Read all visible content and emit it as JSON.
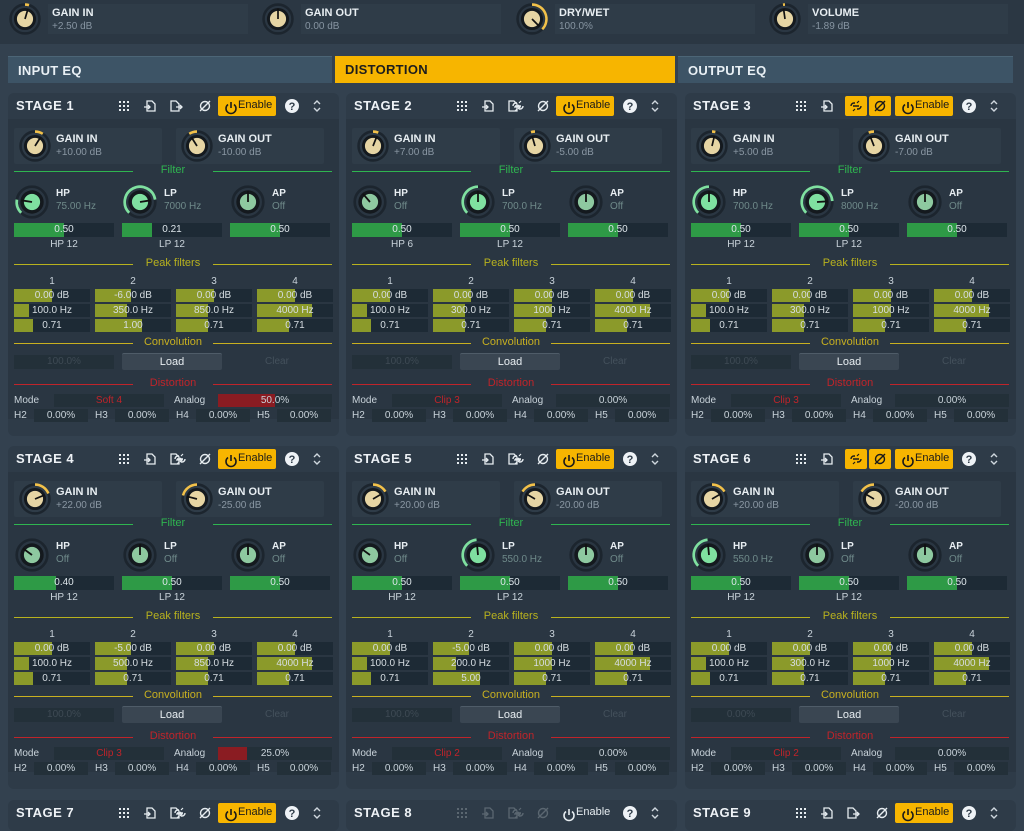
{
  "top": {
    "knobs": [
      {
        "name": "GAIN IN",
        "value": "+2.50 dB"
      },
      {
        "name": "GAIN OUT",
        "value": "0.00 dB"
      },
      {
        "name": "DRY/WET",
        "value": "100.0%"
      },
      {
        "name": "VOLUME",
        "value": "-1.89 dB"
      }
    ]
  },
  "sections": [
    {
      "label": "INPUT EQ",
      "active": false
    },
    {
      "label": "DISTORTION",
      "active": true
    },
    {
      "label": "OUTPUT EQ",
      "active": false
    }
  ],
  "colors": {
    "accent": "#f7b500",
    "filter": "#2fb550",
    "peak": "#b8b21e",
    "convolution": "#c8b020",
    "distortion": "#c0242a",
    "bar_green": "#2e9a46",
    "bar_olive": "#8b9a2a",
    "text_muted": "#8a97a3"
  },
  "labels": {
    "enable": "Enable",
    "gain_in": "GAIN IN",
    "gain_out": "GAIN OUT",
    "filter": "Filter",
    "peak_filters": "Peak filters",
    "convolution": "Convolution",
    "distortion": "Distortion",
    "hp": "HP",
    "lp": "LP",
    "ap": "AP",
    "load": "Load",
    "clear": "Clear",
    "mode": "Mode",
    "analog": "Analog",
    "h2": "H2",
    "h3": "H3",
    "h4": "H4",
    "h5": "H5",
    "peak_nums": [
      "1",
      "2",
      "3",
      "4"
    ]
  },
  "icons": {
    "grid": "grid-icon",
    "import": "import-icon",
    "export": "export-icon",
    "link": "link-icon",
    "phase": "phase-invert-icon",
    "power": "power-icon",
    "help": "help-icon",
    "expand": "expand-icon"
  },
  "stages": [
    {
      "title": "STAGE 1",
      "enabled": true,
      "link_active": false,
      "phase_active": false,
      "show_link": false,
      "gain_in": "+10.00 dB",
      "gain_out": "-10.00 dB",
      "gain_in_level": 0.62,
      "gain_out_level": 0.38,
      "hp": {
        "value": "75.00 Hz",
        "active": true,
        "level": 0.2
      },
      "lp": {
        "value": "7000 Hz",
        "active": true,
        "level": 0.8
      },
      "ap": {
        "value": "Off",
        "active": false,
        "level": 0.5
      },
      "hp_q": "0.50",
      "hp_q_level": 0.5,
      "lp_q": "0.21",
      "lp_q_level": 0.3,
      "ap_q": "0.50",
      "ap_q_level": 0.5,
      "hp_slope": "HP 12",
      "lp_slope": "LP 12",
      "peaks": [
        {
          "gain": "0.00 dB",
          "freq": "100.0 Hz",
          "q": "0.71",
          "gain_level": 0.5,
          "freq_level": 0.2,
          "q_level": 0.25
        },
        {
          "gain": "-6.00 dB",
          "freq": "350.0 Hz",
          "q": "1.00",
          "gain_level": 0.47,
          "freq_level": 0.42,
          "q_level": 0.62
        },
        {
          "gain": "0.00 dB",
          "freq": "850.0 Hz",
          "q": "0.71",
          "gain_level": 0.5,
          "freq_level": 0.42,
          "q_level": 0.42
        },
        {
          "gain": "0.00 dB",
          "freq": "4000 Hz",
          "q": "0.71",
          "gain_level": 0.5,
          "freq_level": 0.72,
          "q_level": 0.42
        }
      ],
      "conv": "100.0%",
      "mode": "Soft 4",
      "analog": "50.0%",
      "analog_level": 0.5,
      "h2": "0.00%",
      "h3": "0.00%",
      "h4": "0.00%",
      "h5": "0.00%"
    },
    {
      "title": "STAGE 2",
      "enabled": true,
      "link_active": false,
      "phase_active": false,
      "show_link": true,
      "gain_in": "+7.00 dB",
      "gain_out": "-5.00 dB",
      "gain_in_level": 0.58,
      "gain_out_level": 0.44,
      "hp": {
        "value": "Off",
        "active": false,
        "level": 0.35
      },
      "lp": {
        "value": "700.0 Hz",
        "active": true,
        "level": 0.5
      },
      "ap": {
        "value": "Off",
        "active": false,
        "level": 0.5
      },
      "hp_q": "0.50",
      "hp_q_level": 0.5,
      "lp_q": "0.50",
      "lp_q_level": 0.5,
      "ap_q": "0.50",
      "ap_q_level": 0.5,
      "hp_slope": "HP 6",
      "lp_slope": "LP 12",
      "peaks": [
        {
          "gain": "0.00 dB",
          "freq": "100.0 Hz",
          "q": "0.71",
          "gain_level": 0.5,
          "freq_level": 0.2,
          "q_level": 0.25
        },
        {
          "gain": "0.00 dB",
          "freq": "300.0 Hz",
          "q": "0.71",
          "gain_level": 0.5,
          "freq_level": 0.42,
          "q_level": 0.42
        },
        {
          "gain": "0.00 dB",
          "freq": "1000 Hz",
          "q": "0.71",
          "gain_level": 0.5,
          "freq_level": 0.5,
          "q_level": 0.42
        },
        {
          "gain": "0.00 dB",
          "freq": "4000 Hz",
          "q": "0.71",
          "gain_level": 0.5,
          "freq_level": 0.72,
          "q_level": 0.42
        }
      ],
      "conv": "100.0%",
      "mode": "Clip 3",
      "analog": "0.00%",
      "analog_level": 0.0,
      "h2": "0.00%",
      "h3": "0.00%",
      "h4": "0.00%",
      "h5": "0.00%"
    },
    {
      "title": "STAGE 3",
      "enabled": true,
      "link_active": true,
      "phase_active": true,
      "show_link": true,
      "gain_in": "+5.00 dB",
      "gain_out": "-7.00 dB",
      "gain_in_level": 0.55,
      "gain_out_level": 0.42,
      "hp": {
        "value": "700.0 Hz",
        "active": true,
        "level": 0.5
      },
      "lp": {
        "value": "8000 Hz",
        "active": true,
        "level": 0.82
      },
      "ap": {
        "value": "Off",
        "active": false,
        "level": 0.5
      },
      "hp_q": "0.50",
      "hp_q_level": 0.5,
      "lp_q": "0.50",
      "lp_q_level": 0.5,
      "ap_q": "0.50",
      "ap_q_level": 0.5,
      "hp_slope": "HP 12",
      "lp_slope": "LP 12",
      "peaks": [
        {
          "gain": "0.00 dB",
          "freq": "100.0 Hz",
          "q": "0.71",
          "gain_level": 0.5,
          "freq_level": 0.2,
          "q_level": 0.25
        },
        {
          "gain": "0.00 dB",
          "freq": "300.0 Hz",
          "q": "0.71",
          "gain_level": 0.5,
          "freq_level": 0.42,
          "q_level": 0.42
        },
        {
          "gain": "0.00 dB",
          "freq": "1000 Hz",
          "q": "0.71",
          "gain_level": 0.5,
          "freq_level": 0.5,
          "q_level": 0.42
        },
        {
          "gain": "0.00 dB",
          "freq": "4000 Hz",
          "q": "0.71",
          "gain_level": 0.5,
          "freq_level": 0.72,
          "q_level": 0.42
        }
      ],
      "conv": "100.0%",
      "mode": "Clip 3",
      "analog": "0.00%",
      "analog_level": 0.0,
      "h2": "0.00%",
      "h3": "0.00%",
      "h4": "0.00%",
      "h5": "0.00%"
    },
    {
      "title": "STAGE 4",
      "enabled": true,
      "link_active": false,
      "phase_active": false,
      "show_link": true,
      "gain_in": "+22.00 dB",
      "gain_out": "-25.00 dB",
      "gain_in_level": 0.75,
      "gain_out_level": 0.22,
      "hp": {
        "value": "Off",
        "active": false,
        "level": 0.3
      },
      "lp": {
        "value": "Off",
        "active": false,
        "level": 0.5
      },
      "ap": {
        "value": "Off",
        "active": false,
        "level": 0.5
      },
      "hp_q": "0.40",
      "hp_q_level": 0.42,
      "lp_q": "0.50",
      "lp_q_level": 0.5,
      "ap_q": "0.50",
      "ap_q_level": 0.5,
      "hp_slope": "HP 12",
      "lp_slope": "LP 12",
      "peaks": [
        {
          "gain": "0.00 dB",
          "freq": "100.0 Hz",
          "q": "0.71",
          "gain_level": 0.5,
          "freq_level": 0.2,
          "q_level": 0.25
        },
        {
          "gain": "-5.00 dB",
          "freq": "500.0 Hz",
          "q": "0.71",
          "gain_level": 0.47,
          "freq_level": 0.42,
          "q_level": 0.42
        },
        {
          "gain": "0.00 dB",
          "freq": "850.0 Hz",
          "q": "0.71",
          "gain_level": 0.5,
          "freq_level": 0.42,
          "q_level": 0.42
        },
        {
          "gain": "0.00 dB",
          "freq": "4000 Hz",
          "q": "0.71",
          "gain_level": 0.5,
          "freq_level": 0.72,
          "q_level": 0.42
        }
      ],
      "conv": "100.0%",
      "mode": "Clip 3",
      "analog": "25.0%",
      "analog_level": 0.25,
      "h2": "0.00%",
      "h3": "0.00%",
      "h4": "0.00%",
      "h5": "0.00%"
    },
    {
      "title": "STAGE 5",
      "enabled": true,
      "link_active": false,
      "phase_active": false,
      "show_link": true,
      "gain_in": "+20.00 dB",
      "gain_out": "-20.00 dB",
      "gain_in_level": 0.72,
      "gain_out_level": 0.28,
      "hp": {
        "value": "Off",
        "active": false,
        "level": 0.3
      },
      "lp": {
        "value": "550.0 Hz",
        "active": true,
        "level": 0.48
      },
      "ap": {
        "value": "Off",
        "active": false,
        "level": 0.5
      },
      "hp_q": "0.50",
      "hp_q_level": 0.5,
      "lp_q": "0.50",
      "lp_q_level": 0.5,
      "ap_q": "0.50",
      "ap_q_level": 0.5,
      "hp_slope": "HP 12",
      "lp_slope": "LP 12",
      "peaks": [
        {
          "gain": "0.00 dB",
          "freq": "100.0 Hz",
          "q": "0.71",
          "gain_level": 0.5,
          "freq_level": 0.2,
          "q_level": 0.25
        },
        {
          "gain": "-5.00 dB",
          "freq": "200.0 Hz",
          "q": "5.00",
          "gain_level": 0.47,
          "freq_level": 0.3,
          "q_level": 0.62
        },
        {
          "gain": "0.00 dB",
          "freq": "1000 Hz",
          "q": "0.71",
          "gain_level": 0.5,
          "freq_level": 0.5,
          "q_level": 0.42
        },
        {
          "gain": "0.00 dB",
          "freq": "4000 Hz",
          "q": "0.71",
          "gain_level": 0.5,
          "freq_level": 0.72,
          "q_level": 0.42
        }
      ],
      "conv": "100.0%",
      "mode": "Clip 2",
      "analog": "0.00%",
      "analog_level": 0.0,
      "h2": "0.00%",
      "h3": "0.00%",
      "h4": "0.00%",
      "h5": "0.00%"
    },
    {
      "title": "STAGE 6",
      "enabled": true,
      "link_active": true,
      "phase_active": true,
      "show_link": true,
      "gain_in": "+20.00 dB",
      "gain_out": "-20.00 dB",
      "gain_in_level": 0.72,
      "gain_out_level": 0.28,
      "hp": {
        "value": "550.0 Hz",
        "active": true,
        "level": 0.48
      },
      "lp": {
        "value": "Off",
        "active": false,
        "level": 0.5
      },
      "ap": {
        "value": "Off",
        "active": false,
        "level": 0.5
      },
      "hp_q": "0.50",
      "hp_q_level": 0.5,
      "lp_q": "0.50",
      "lp_q_level": 0.5,
      "ap_q": "0.50",
      "ap_q_level": 0.5,
      "hp_slope": "HP 12",
      "lp_slope": "LP 12",
      "peaks": [
        {
          "gain": "0.00 dB",
          "freq": "100.0 Hz",
          "q": "0.71",
          "gain_level": 0.5,
          "freq_level": 0.2,
          "q_level": 0.25
        },
        {
          "gain": "0.00 dB",
          "freq": "300.0 Hz",
          "q": "0.71",
          "gain_level": 0.5,
          "freq_level": 0.42,
          "q_level": 0.42
        },
        {
          "gain": "0.00 dB",
          "freq": "1000 Hz",
          "q": "0.71",
          "gain_level": 0.5,
          "freq_level": 0.5,
          "q_level": 0.42
        },
        {
          "gain": "0.00 dB",
          "freq": "4000 Hz",
          "q": "0.71",
          "gain_level": 0.5,
          "freq_level": 0.72,
          "q_level": 0.42
        }
      ],
      "conv": "0.00%",
      "mode": "Clip 2",
      "analog": "0.00%",
      "analog_level": 0.0,
      "h2": "0.00%",
      "h3": "0.00%",
      "h4": "0.00%",
      "h5": "0.00%"
    },
    {
      "title": "STAGE 7",
      "enabled": true,
      "link_active": false,
      "phase_active": false,
      "show_link": true,
      "header_only": true
    },
    {
      "title": "STAGE 8",
      "enabled": false,
      "link_active": false,
      "phase_active": false,
      "show_link": true,
      "header_only": true
    },
    {
      "title": "STAGE 9",
      "enabled": true,
      "link_active": false,
      "phase_active": false,
      "show_link": false,
      "header_only": true
    }
  ]
}
